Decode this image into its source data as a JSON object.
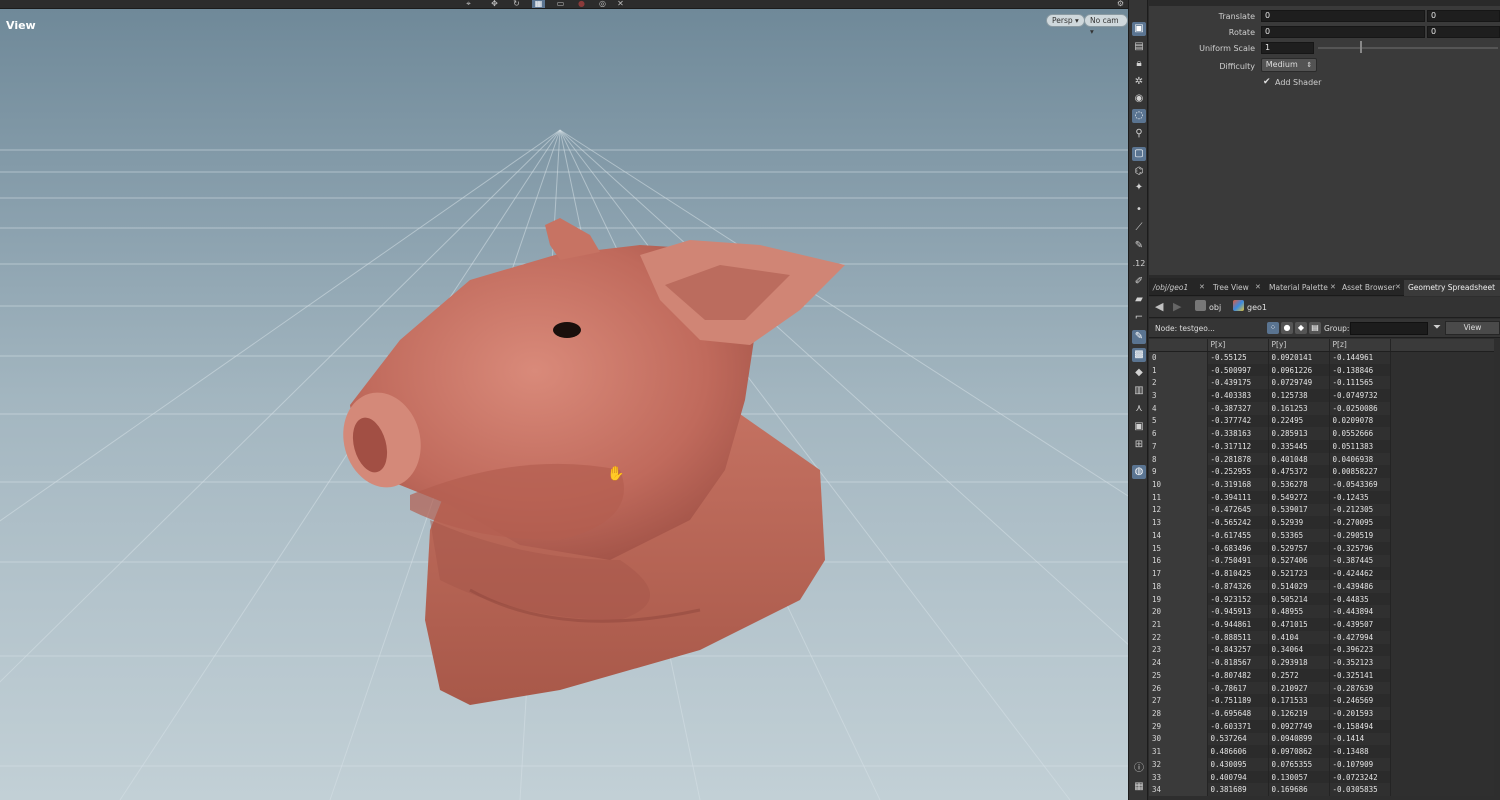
{
  "viewport": {
    "label": "View",
    "persp_button": "Persp ▾",
    "cam_button": "No cam ▾",
    "grid": "on",
    "model": "pig head"
  },
  "toolbar_icons": [
    "select-icon",
    "transform-icon",
    "rotate-icon",
    "snap-icon",
    "display-icon",
    "camera-icon",
    "close-icon"
  ],
  "parameters": {
    "translate": {
      "label": "Translate",
      "x": "0",
      "y": "0"
    },
    "rotate": {
      "label": "Rotate",
      "x": "0",
      "y": "0"
    },
    "uniform_scale": {
      "label": "Uniform Scale",
      "value": "1"
    },
    "difficulty": {
      "label": "Difficulty",
      "value": "Medium"
    },
    "add_shader": {
      "label": "Add Shader",
      "checked": true
    }
  },
  "shelf_icons": [
    "cam-icon",
    "texture-icon",
    "lock-icon",
    "light-icon",
    "sphere-icon",
    "bulb-icon",
    "pin-icon",
    "frame-icon",
    "camera-tool-icon",
    "hand-icon",
    "dot-icon",
    "brush-icon",
    "pen-icon",
    "number-icon",
    "paint-icon",
    "eraser-icon",
    "crop-icon",
    "shade-icon",
    "wire-icon",
    "diamond-icon",
    "book-icon",
    "joint-icon",
    "box-icon",
    "render-icon",
    "light-bulb-icon",
    "info-icon",
    "grid-icon"
  ],
  "tabs": [
    {
      "label": "/obj/geo1"
    },
    {
      "label": "Tree View"
    },
    {
      "label": "Material Palette"
    },
    {
      "label": "Asset Browser"
    },
    {
      "label": "Geometry Spreadsheet",
      "active": true
    }
  ],
  "path": {
    "seg1": "obj",
    "seg2": "geo1"
  },
  "nodebar": {
    "node_label": "Node: testgeo...",
    "group_label": "Group:",
    "group_value": "",
    "view_button": "View"
  },
  "spreadsheet": {
    "columns": [
      "",
      "P[x]",
      "P[y]",
      "P[z]"
    ],
    "rows": [
      [
        "0",
        "-0.55125",
        "0.0920141",
        "-0.144961"
      ],
      [
        "1",
        "-0.500997",
        "0.0961226",
        "-0.138846"
      ],
      [
        "2",
        "-0.439175",
        "0.0729749",
        "-0.111565"
      ],
      [
        "3",
        "-0.403383",
        "0.125738",
        "-0.0749732"
      ],
      [
        "4",
        "-0.387327",
        "0.161253",
        "-0.0250086"
      ],
      [
        "5",
        "-0.377742",
        "0.22495",
        "0.0209078"
      ],
      [
        "6",
        "-0.338163",
        "0.285913",
        "0.0552666"
      ],
      [
        "7",
        "-0.317112",
        "0.335445",
        "0.0511383"
      ],
      [
        "8",
        "-0.281878",
        "0.401048",
        "0.0406938"
      ],
      [
        "9",
        "-0.252955",
        "0.475372",
        "0.00858227"
      ],
      [
        "10",
        "-0.319168",
        "0.536278",
        "-0.0543369"
      ],
      [
        "11",
        "-0.394111",
        "0.549272",
        "-0.12435"
      ],
      [
        "12",
        "-0.472645",
        "0.539017",
        "-0.212305"
      ],
      [
        "13",
        "-0.565242",
        "0.52939",
        "-0.270095"
      ],
      [
        "14",
        "-0.617455",
        "0.53365",
        "-0.290519"
      ],
      [
        "15",
        "-0.683496",
        "0.529757",
        "-0.325796"
      ],
      [
        "16",
        "-0.750491",
        "0.527406",
        "-0.387445"
      ],
      [
        "17",
        "-0.810425",
        "0.521723",
        "-0.424462"
      ],
      [
        "18",
        "-0.874326",
        "0.514029",
        "-0.439486"
      ],
      [
        "19",
        "-0.923152",
        "0.505214",
        "-0.44835"
      ],
      [
        "20",
        "-0.945913",
        "0.48955",
        "-0.443894"
      ],
      [
        "21",
        "-0.944861",
        "0.471015",
        "-0.439507"
      ],
      [
        "22",
        "-0.888511",
        "0.4104",
        "-0.427994"
      ],
      [
        "23",
        "-0.843257",
        "0.34064",
        "-0.396223"
      ],
      [
        "24",
        "-0.818567",
        "0.293918",
        "-0.352123"
      ],
      [
        "25",
        "-0.807482",
        "0.2572",
        "-0.325141"
      ],
      [
        "26",
        "-0.78617",
        "0.210927",
        "-0.287639"
      ],
      [
        "27",
        "-0.751189",
        "0.171533",
        "-0.246569"
      ],
      [
        "28",
        "-0.695648",
        "0.126219",
        "-0.201593"
      ],
      [
        "29",
        "-0.603371",
        "0.0927749",
        "-0.158494"
      ],
      [
        "30",
        "0.537264",
        "0.0940899",
        "-0.1414"
      ],
      [
        "31",
        "0.486606",
        "0.0970862",
        "-0.13488"
      ],
      [
        "32",
        "0.430095",
        "0.0765355",
        "-0.107909"
      ],
      [
        "33",
        "0.400794",
        "0.130057",
        "-0.0723242"
      ],
      [
        "34",
        "0.381689",
        "0.169686",
        "-0.0305835"
      ]
    ]
  },
  "colors": {
    "skin": "#c46e60",
    "sky_top": "#6e8898",
    "panel": "#3a3a3a",
    "selected": "#5a7491"
  }
}
